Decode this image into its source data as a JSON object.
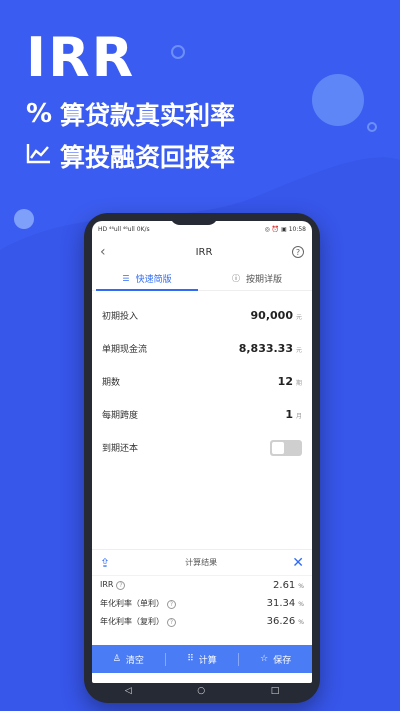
{
  "promo": {
    "title": "IRR",
    "line1_icon": "%",
    "line1_text": "算贷款真实利率",
    "line2_icon": "chart-line-icon",
    "line2_text": "算投融资回报率"
  },
  "status_bar": {
    "left": "HD ⁴⁶ull ⁴⁶ull 0K/s",
    "right": "◎ ⏰ ▣ 10:58"
  },
  "app": {
    "title": "IRR",
    "tabs": [
      {
        "label": "快速简版",
        "active": true
      },
      {
        "label": "按期详版",
        "active": false
      }
    ],
    "form": [
      {
        "label": "初期投入",
        "value": "90,000",
        "unit": "元"
      },
      {
        "label": "单期现金流",
        "value": "8,833.33",
        "unit": "元"
      },
      {
        "label": "期数",
        "value": "12",
        "unit": "期"
      },
      {
        "label": "每期跨度",
        "value": "1",
        "unit": "月"
      }
    ],
    "toggle_label": "到期还本",
    "toggle_on": false,
    "result": {
      "title": "计算结果",
      "rows": [
        {
          "label": "IRR",
          "value": "2.61",
          "unit": "%"
        },
        {
          "label": "年化利率（单利）",
          "value": "31.34",
          "unit": "%"
        },
        {
          "label": "年化利率（复利）",
          "value": "36.26",
          "unit": "%"
        }
      ]
    },
    "actions": {
      "clear": "清空",
      "calculate": "计算",
      "save": "保存"
    }
  },
  "colors": {
    "background": "#3b5cf0",
    "accent": "#2f6bf5",
    "bottom_bar": "#4a7cf5"
  }
}
